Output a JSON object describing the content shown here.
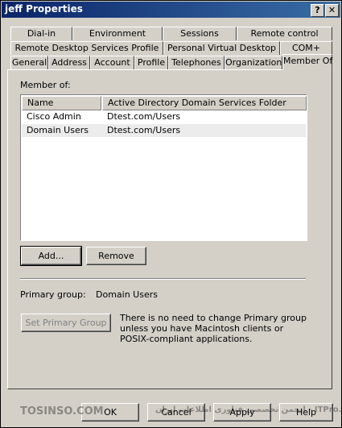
{
  "window": {
    "title": "jeff Properties",
    "help_label": "?",
    "close_label": "✕"
  },
  "tabs": {
    "row1": [
      "Dial-in",
      "Environment",
      "Sessions",
      "Remote control"
    ],
    "row2": [
      "Remote Desktop Services Profile",
      "Personal Virtual Desktop",
      "COM+"
    ],
    "row3": [
      "General",
      "Address",
      "Account",
      "Profile",
      "Telephones",
      "Organization",
      "Member Of"
    ],
    "active": "Member Of"
  },
  "member_of": {
    "label": "Member of:",
    "columns": [
      "Name",
      "Active Directory Domain Services Folder"
    ],
    "rows": [
      {
        "name": "Cisco Admin",
        "folder": "Dtest.com/Users"
      },
      {
        "name": "Domain Users",
        "folder": "Dtest.com/Users"
      }
    ],
    "add_label": "Add...",
    "remove_label": "Remove"
  },
  "primary_group": {
    "label": "Primary group:",
    "value": "Domain Users",
    "set_button_label": "Set Primary Group",
    "info_text": "There is no need to change Primary group unless you have Macintosh clients or POSIX-compliant applications."
  },
  "footer": {
    "ok_label": "OK",
    "cancel_label": "Cancel",
    "apply_label": "Apply",
    "help_label": "Help"
  },
  "watermark": {
    "left": "TOSINSO.COM",
    "right": "انجمن تخصصی فناوری اطلاعات ایران - ITPro.ir"
  }
}
